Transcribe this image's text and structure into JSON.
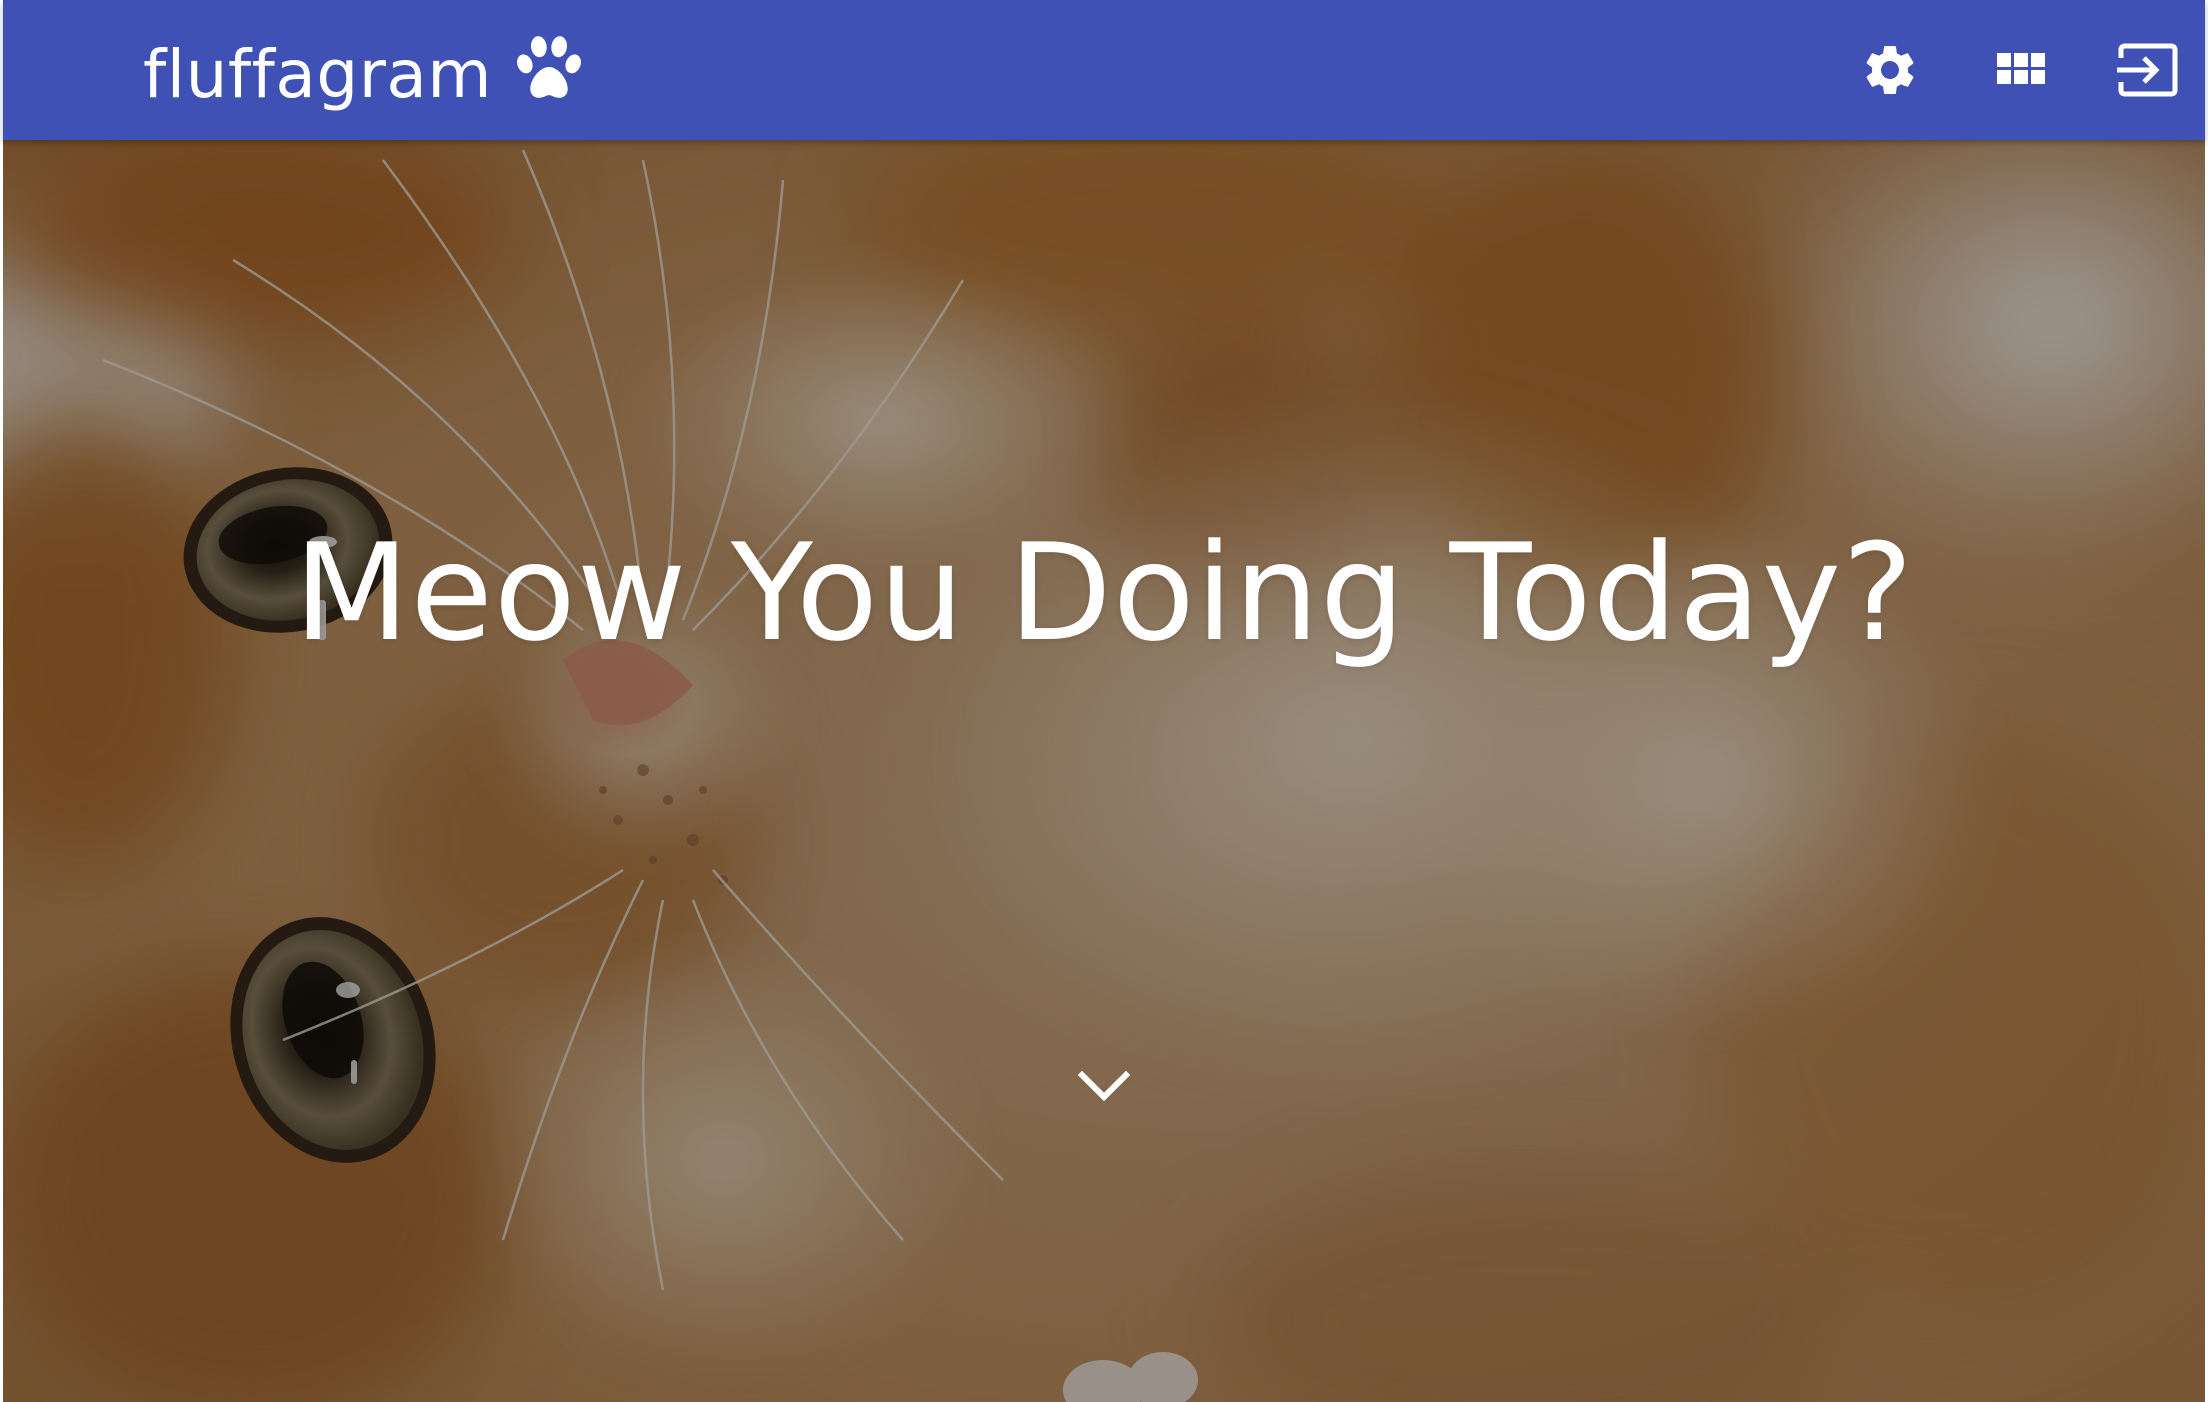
{
  "app": {
    "brand_name": "fluffagram",
    "brand_icon": "paw-icon"
  },
  "toolbar": {
    "buttons": [
      {
        "icon": "gear-icon",
        "label": "Settings"
      },
      {
        "icon": "apps-grid-icon",
        "label": "Apps"
      },
      {
        "icon": "sign-in-icon",
        "label": "Sign in"
      }
    ]
  },
  "hero": {
    "title": "Meow You Doing Today?",
    "scroll_icon": "chevron-down-icon",
    "image": "photo of an orange tabby kitten, upside down, with dark overlay"
  },
  "colors": {
    "appbar": "#3f51b5",
    "appbar_text": "#ffffff",
    "hero_text": "#ffffff",
    "overlay": "rgba(0,0,0,0.36)"
  }
}
